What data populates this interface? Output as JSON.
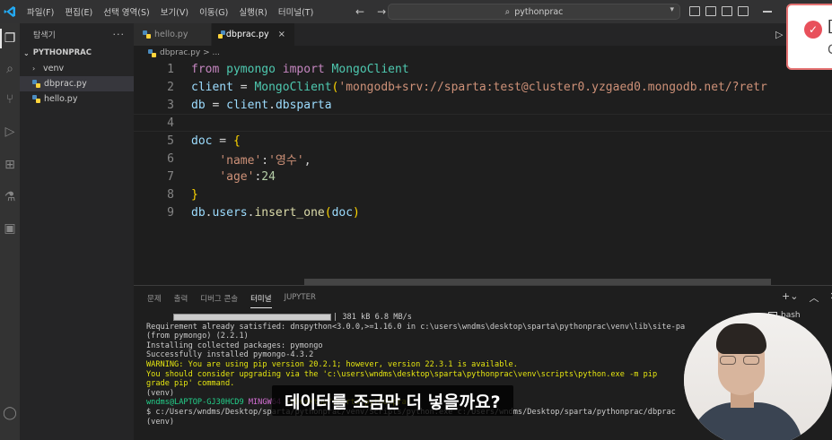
{
  "titlebar": {
    "menu": [
      "파일(F)",
      "편집(E)",
      "선택 영역(S)",
      "보기(V)",
      "이동(G)",
      "실행(R)",
      "터미널(T)"
    ],
    "search": "pythonprac"
  },
  "sidebar": {
    "title": "탐색기",
    "more": "···",
    "folder": "PYTHONPRAC",
    "items": [
      {
        "label": "venv",
        "type": "folder"
      },
      {
        "label": "dbprac.py",
        "type": "file"
      },
      {
        "label": "hello.py",
        "type": "file"
      }
    ]
  },
  "tabs": [
    {
      "label": "hello.py",
      "active": false
    },
    {
      "label": "dbprac.py",
      "active": true,
      "close": "×"
    }
  ],
  "breadcrumb": "dbprac.py > ...",
  "editor": {
    "line_numbers": [
      "1",
      "2",
      "3",
      "4",
      "5",
      "6",
      "7",
      "8",
      "9"
    ],
    "lines": [
      [
        {
          "t": "from",
          "c": "kw"
        },
        {
          "t": " pymongo ",
          "c": "cls"
        },
        {
          "t": "import",
          "c": "kw"
        },
        {
          "t": " MongoClient",
          "c": "cls"
        }
      ],
      [
        {
          "t": "client",
          "c": "var"
        },
        {
          "t": " = ",
          "c": ""
        },
        {
          "t": "MongoClient",
          "c": "cls"
        },
        {
          "t": "(",
          "c": "br1"
        },
        {
          "t": "'mongodb+srv://sparta:test@cluster0.yzgaed0.mongodb.net/?retr",
          "c": "str"
        }
      ],
      [
        {
          "t": "db",
          "c": "var"
        },
        {
          "t": " = ",
          "c": ""
        },
        {
          "t": "client",
          "c": "var"
        },
        {
          "t": ".",
          "c": ""
        },
        {
          "t": "dbsparta",
          "c": "var"
        }
      ],
      [],
      [
        {
          "t": "doc",
          "c": "var"
        },
        {
          "t": " = ",
          "c": ""
        },
        {
          "t": "{",
          "c": "br1"
        }
      ],
      [
        {
          "t": "    ",
          "c": ""
        },
        {
          "t": "'name'",
          "c": "str"
        },
        {
          "t": ":",
          "c": ""
        },
        {
          "t": "'영수'",
          "c": "str"
        },
        {
          "t": ",",
          "c": ""
        }
      ],
      [
        {
          "t": "    ",
          "c": ""
        },
        {
          "t": "'age'",
          "c": "str"
        },
        {
          "t": ":",
          "c": ""
        },
        {
          "t": "24",
          "c": "num"
        }
      ],
      [
        {
          "t": "}",
          "c": "br1"
        }
      ],
      [
        {
          "t": "db",
          "c": "var"
        },
        {
          "t": ".",
          "c": ""
        },
        {
          "t": "users",
          "c": "var"
        },
        {
          "t": ".",
          "c": ""
        },
        {
          "t": "insert_one",
          "c": "fn"
        },
        {
          "t": "(",
          "c": "br1"
        },
        {
          "t": "doc",
          "c": "var"
        },
        {
          "t": ")",
          "c": "br1"
        }
      ]
    ]
  },
  "panel": {
    "tabs": [
      "문제",
      "출력",
      "디버그 콘솔",
      "터미널",
      "JUPYTER"
    ],
    "active_tab": "터미널",
    "shell": "bash",
    "terminal": [
      {
        "t": "381 kB 6.8 MB/s",
        "c": "",
        "progress": true
      },
      {
        "t": "Requirement already satisfied: dnspython<3.0.0,>=1.16.0 in c:\\users\\wndms\\desktop\\sparta\\pythonprac\\venv\\lib\\site-pa",
        "c": ""
      },
      {
        "t": "(from pymongo) (2.2.1)",
        "c": ""
      },
      {
        "t": "Installing collected packages: pymongo",
        "c": ""
      },
      {
        "t": "Successfully installed pymongo-4.3.2",
        "c": ""
      },
      {
        "t": "WARNING: You are using pip version 20.2.1; however, version 22.3.1 is available.",
        "c": "warn"
      },
      {
        "t": "You should consider upgrading via the 'c:\\users\\wndms\\desktop\\sparta\\pythonprac\\venv\\scripts\\python.exe -m pip",
        "c": "warn"
      },
      {
        "t": "grade pip' command.",
        "c": "warn"
      },
      {
        "t": "(venv)",
        "c": ""
      },
      {
        "t": "wndms@LAPTOP-GJ30HCD9 MINGW64 ~/Desktop/sparta/pythonprac",
        "c": "prompt"
      },
      {
        "t": "$ c:/Users/wndms/Desktop/sparta/pythonprac/venv/Scripts/python.exe c:/Users/wndms/Desktop/sparta/pythonprac/dbprac",
        "c": ""
      },
      {
        "t": "(venv)",
        "c": ""
      }
    ]
  },
  "subtitle": "데이터를 조금만 더 넣을까요?",
  "toast": {
    "title": "[",
    "sub": "C"
  }
}
